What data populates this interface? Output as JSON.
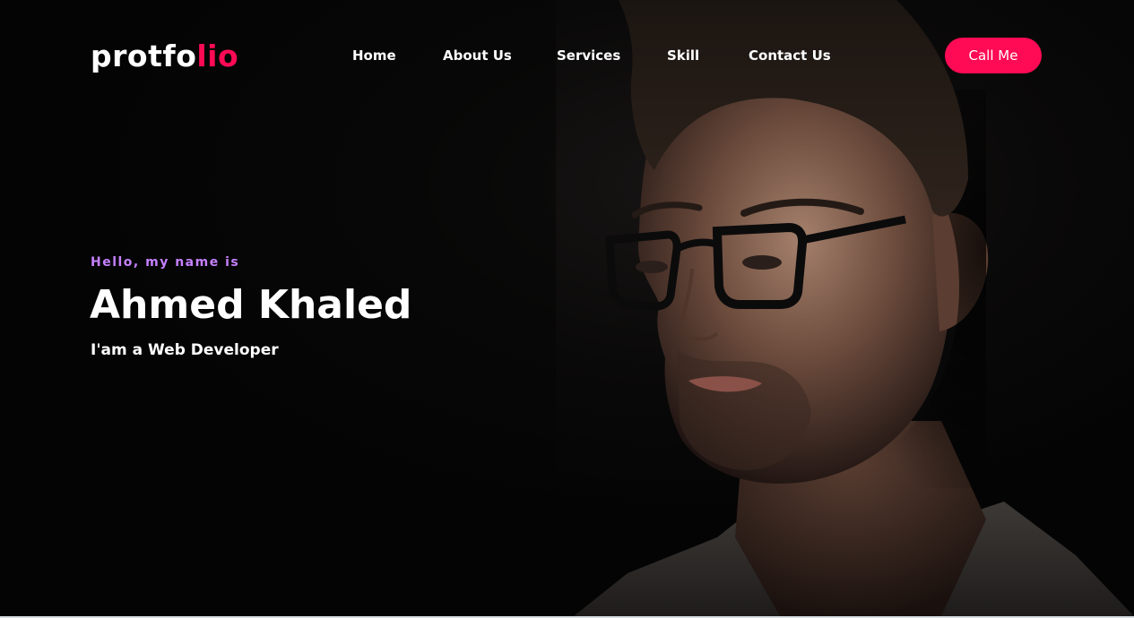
{
  "brand": {
    "logo_main": "protfo",
    "logo_accent": "lio",
    "accent_color": "#ff0a54"
  },
  "nav": {
    "items": [
      {
        "label": "Home"
      },
      {
        "label": "About Us"
      },
      {
        "label": "Services"
      },
      {
        "label": "Skill"
      },
      {
        "label": "Contact Us"
      }
    ],
    "cta_label": "Call Me"
  },
  "hero": {
    "greeting": "Hello, my name is",
    "name": "Ahmed Khaled",
    "role": "I'am a Web Developer",
    "greeting_color": "#c581ff",
    "background_image": "portrait-photo"
  }
}
